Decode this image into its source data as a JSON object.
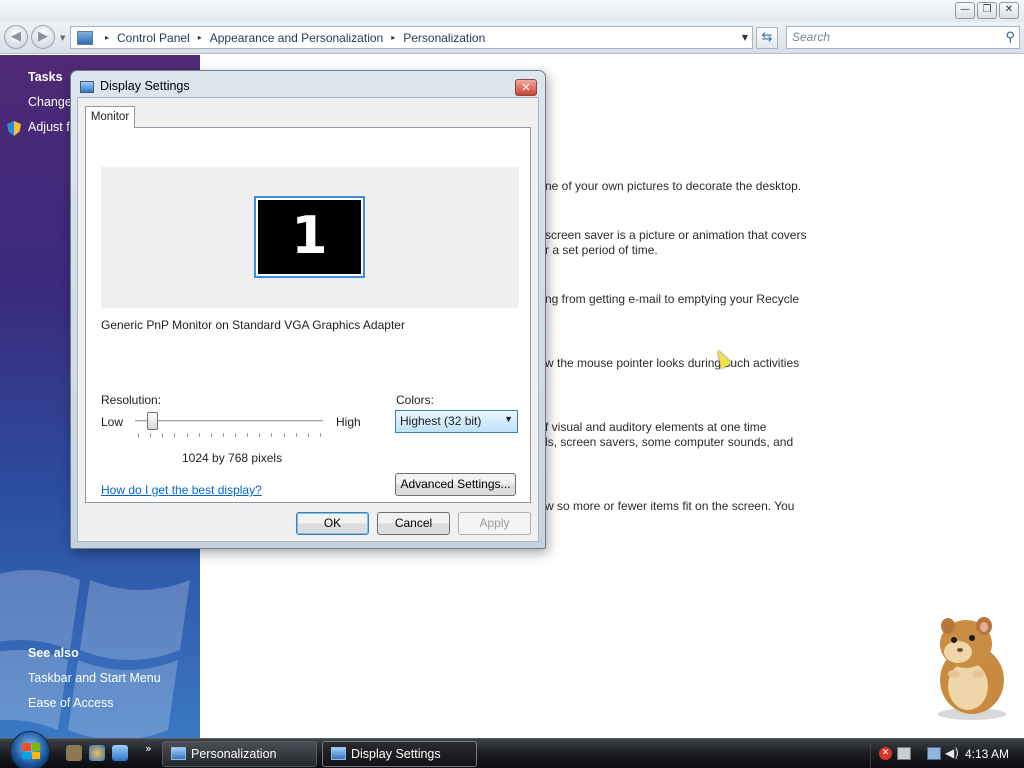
{
  "window": {
    "minimize": "—",
    "maximize": "❐",
    "close": "✕"
  },
  "nav": {
    "back": "◀",
    "forward": "▶",
    "refresh": "⇆"
  },
  "address": {
    "crumbs": [
      "Control Panel",
      "Appearance and Personalization",
      "Personalization"
    ],
    "separator": "▸",
    "dropdown": "▼"
  },
  "search": {
    "placeholder": "Search",
    "icon": "⚲"
  },
  "sidebar": {
    "tasks_heading": "Tasks",
    "items": [
      "Change",
      "Adjust f"
    ],
    "see_also_heading": "See also",
    "see_also_items": [
      "Taskbar and Start Menu",
      "Ease of Access"
    ]
  },
  "main": {
    "lines": [
      "ne of your own pictures to decorate the desktop.",
      "screen saver is a picture or animation that covers",
      "r a set period of time.",
      "ng from getting e-mail to emptying your Recycle",
      "w the mouse pointer looks during such activities",
      "f visual and auditory elements at one time",
      "ls, screen savers, some computer sounds, and",
      "w so more or fewer items fit on the screen. You"
    ]
  },
  "dialog": {
    "title": "Display Settings",
    "close": "✕",
    "tab": "Monitor",
    "monitor_number": "1",
    "monitor_name": "Generic PnP Monitor on Standard VGA Graphics Adapter",
    "resolution_label": "Resolution:",
    "low_label": "Low",
    "high_label": "High",
    "resolution_value": "1024 by 768 pixels",
    "resolution_slider_level": 0.09,
    "colors_label": "Colors:",
    "colors_value": "Highest (32 bit)",
    "colors_arrow": "▼",
    "help_link": "How do I get the best display?",
    "advanced_button": "Advanced Settings...",
    "ok_button": "OK",
    "cancel_button": "Cancel",
    "apply_button": "Apply"
  },
  "taskbar": {
    "ql_chevron": "»",
    "tasks": [
      "Personalization",
      "Display Settings"
    ],
    "clock": "4:13 AM",
    "warn": "✕",
    "volume": "◀)"
  }
}
